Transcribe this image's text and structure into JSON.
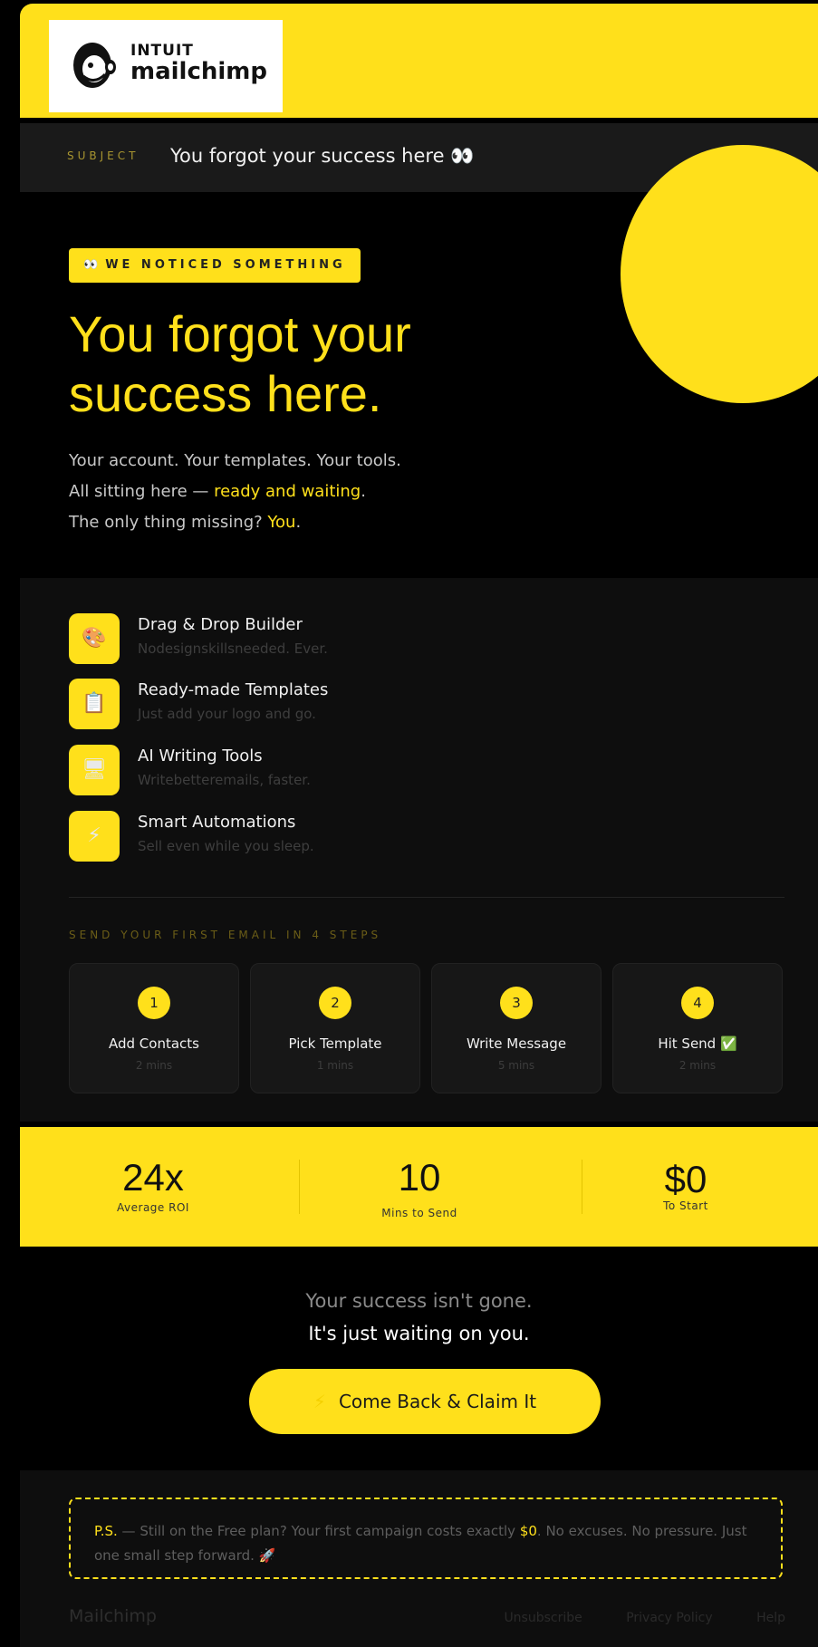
{
  "header": {
    "logo_brand_top": "INTUIT",
    "logo_brand": "mailchimp"
  },
  "subject": {
    "label": "SUBJECT",
    "text": "You forgot your success here 👀"
  },
  "hero": {
    "badge_icon": "👀",
    "badge_text": "WE NOTICED SOMETHING",
    "headline_line1": "You forgot your",
    "headline_line2": "success here.",
    "intro_line1": "Your account. Your templates. Your tools.",
    "intro_line2_prefix": "All sitting here — ",
    "intro_line2_highlight": "ready and waiting",
    "intro_line2_suffix": ".",
    "intro_line3_prefix": "The only thing missing? ",
    "intro_line3_highlight": "You",
    "intro_line3_suffix": "."
  },
  "features": [
    {
      "icon": "🎨",
      "title": "Drag & Drop Builder",
      "subtitle": "Nodesignskillsneeded. Ever."
    },
    {
      "icon": "📋",
      "title": "Ready-made Templates",
      "subtitle": "Just add your logo and go."
    },
    {
      "icon": "🖥",
      "title": "AI Writing Tools",
      "subtitle": "Writebetteremails, faster."
    },
    {
      "icon": "⚡",
      "title": "Smart Automations",
      "subtitle": "Sell even while you sleep."
    }
  ],
  "steps": {
    "heading": "SEND YOUR FIRST EMAIL IN 4 STEPS",
    "items": [
      {
        "number": "1",
        "title": "Add Contacts",
        "time": "2 mins"
      },
      {
        "number": "2",
        "title": "Pick Template",
        "time": "1 mins"
      },
      {
        "number": "3",
        "title": "Write Message",
        "time": "5 mins"
      },
      {
        "number": "4",
        "title": "Hit Send ✅",
        "time": "2 mins"
      }
    ]
  },
  "stats": [
    {
      "value": "24x",
      "label": "Average ROI"
    },
    {
      "value": "10",
      "label": "Mins to Send"
    },
    {
      "value": "$0",
      "label": "To Start"
    }
  ],
  "closing": {
    "line1": "Your success isn't gone.",
    "line2": "It's just waiting on you.",
    "cta_icon": "⚡",
    "cta_label": "Come Back & Claim It"
  },
  "footer": {
    "ps_label": "P.S.",
    "ps_text_before": " — Still on the Free plan? Your first campaign costs exactly ",
    "ps_amount": "$0",
    "ps_text_after": ". No excuses. No pressure. Just one small step forward. 🚀",
    "brand": "Mailchimp",
    "links": [
      "Unsubscribe",
      "Privacy Policy",
      "Help"
    ]
  },
  "colors": {
    "accent": "#ffe01b",
    "background": "#000000",
    "panel": "#0e0e0e"
  }
}
